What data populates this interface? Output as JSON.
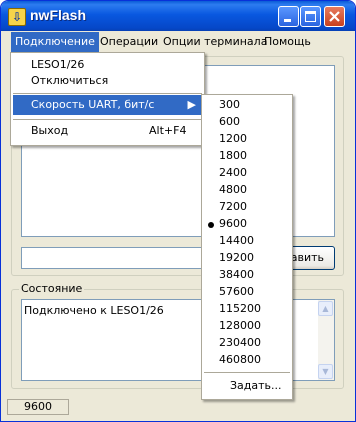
{
  "window": {
    "title": "nwFlash"
  },
  "menubar": {
    "items": [
      "Подключение",
      "Операции",
      "Опции терминала",
      "Помощь"
    ]
  },
  "connection_menu": {
    "items": [
      {
        "label": "LESO1/26",
        "shortcut": ""
      },
      {
        "label": "Отключиться",
        "shortcut": ""
      },
      {
        "label": "Скорость UART, бит/с",
        "shortcut": "",
        "has_submenu": true,
        "highlighted": true
      },
      {
        "label": "Выход",
        "shortcut": "Alt+F4"
      }
    ]
  },
  "uart_speed_menu": {
    "options": [
      "300",
      "600",
      "1200",
      "1800",
      "2400",
      "4800",
      "7200",
      "9600",
      "14400",
      "19200",
      "38400",
      "57600",
      "115200",
      "128000",
      "230400",
      "460800"
    ],
    "selected": "9600",
    "custom_label": "Задать..."
  },
  "send": {
    "button_label": "авить"
  },
  "status_group": {
    "label": "Состояние",
    "log_text": "Подключено к LESO1/26"
  },
  "statusbar": {
    "baud": "9600"
  },
  "colors": {
    "highlight": "#316ac5",
    "titlebar": "#0a5bd6",
    "face": "#ece9d8"
  }
}
